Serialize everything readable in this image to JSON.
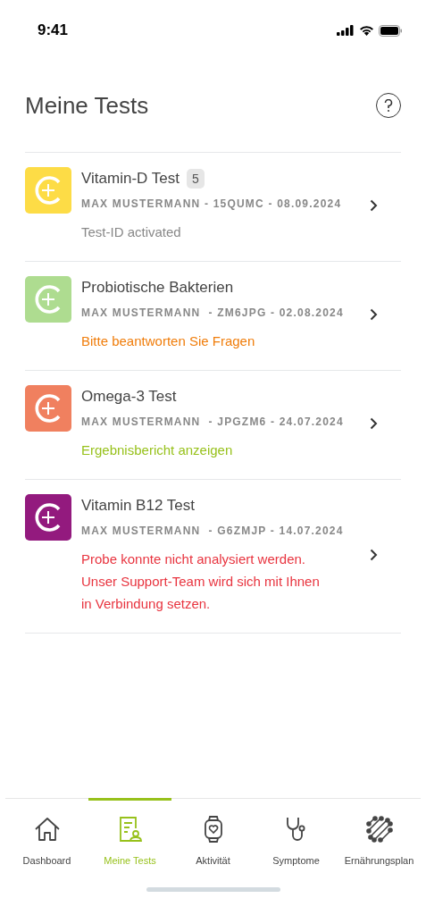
{
  "status_bar": {
    "time": "9:41"
  },
  "header": {
    "title": "Meine Tests"
  },
  "tests": [
    {
      "name": "Vitamin-D Test",
      "badge": "5",
      "meta": "MAX MUSTERMANN - 15QUMC - 08.09.2024",
      "status": "Test-ID activated",
      "kind": "neutral",
      "color": "#fddc46"
    },
    {
      "name": "Probiotische Bakterien",
      "meta": "MAX MUSTERMANN  - ZM6JPG - 02.08.2024",
      "status": "Bitte beantworten Sie Fragen",
      "kind": "warning",
      "color": "#aedc90"
    },
    {
      "name": "Omega-3 Test",
      "meta": "MAX MUSTERMANN  - JPGZM6 - 24.07.2024",
      "status": "Ergebnisbericht anzeigen",
      "kind": "success",
      "color": "#f0805f"
    },
    {
      "name": "Vitamin B12 Test",
      "meta": "MAX MUSTERMANN  - G6ZMJP - 14.07.2024",
      "status": "Probe konnte nicht analysiert werden. Unser Support-Team wird sich mit Ihnen in Verbindung setzen.",
      "kind": "error",
      "color": "#931a7e"
    }
  ],
  "tab_bar": [
    {
      "label": "Dashboard",
      "selected": false
    },
    {
      "label": "Meine Tests",
      "selected": true
    },
    {
      "label": "Aktivität",
      "selected": false
    },
    {
      "label": "Symptome",
      "selected": false
    },
    {
      "label": "Ernährungsplan",
      "selected": false
    }
  ]
}
